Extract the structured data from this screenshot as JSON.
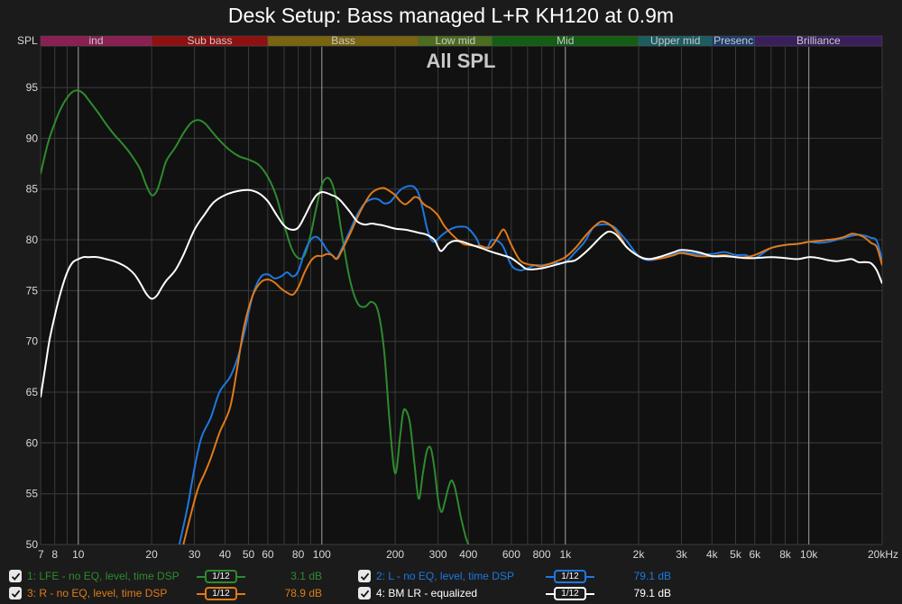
{
  "title": "Desk Setup: Bass managed L+R KH120 at 0.9m",
  "chart_data": {
    "type": "line",
    "subtitle": "All SPL",
    "ylabel": "SPL",
    "xscale": "log",
    "xlim": [
      7,
      20000
    ],
    "ylim": [
      50,
      99
    ],
    "grid": true,
    "x_ticks": [
      {
        "v": 7,
        "label": "7"
      },
      {
        "v": 8,
        "label": "8"
      },
      {
        "v": 10,
        "label": "10"
      },
      {
        "v": 20,
        "label": "20"
      },
      {
        "v": 30,
        "label": "30"
      },
      {
        "v": 40,
        "label": "40"
      },
      {
        "v": 50,
        "label": "50"
      },
      {
        "v": 60,
        "label": "60"
      },
      {
        "v": 80,
        "label": "80"
      },
      {
        "v": 100,
        "label": "100"
      },
      {
        "v": 200,
        "label": "200"
      },
      {
        "v": 300,
        "label": "300"
      },
      {
        "v": 400,
        "label": "400"
      },
      {
        "v": 600,
        "label": "600"
      },
      {
        "v": 800,
        "label": "800"
      },
      {
        "v": 1000,
        "label": "1k"
      },
      {
        "v": 2000,
        "label": "2k"
      },
      {
        "v": 3000,
        "label": "3k"
      },
      {
        "v": 4000,
        "label": "4k"
      },
      {
        "v": 5000,
        "label": "5k"
      },
      {
        "v": 6000,
        "label": "6k"
      },
      {
        "v": 8000,
        "label": "8k"
      },
      {
        "v": 10000,
        "label": "10k"
      },
      {
        "v": 20000,
        "label": "20kHz"
      }
    ],
    "y_ticks": [
      50,
      55,
      60,
      65,
      70,
      75,
      80,
      85,
      90,
      95
    ],
    "bands": [
      {
        "label": "ind",
        "from": 7,
        "to": 20,
        "color": "#8a1f52"
      },
      {
        "label": "Sub bass",
        "from": 20,
        "to": 60,
        "color": "#8e1010"
      },
      {
        "label": "Bass",
        "from": 60,
        "to": 250,
        "color": "#7a6410"
      },
      {
        "label": "Low mid",
        "from": 250,
        "to": 500,
        "color": "#4c6d1e"
      },
      {
        "label": "Mid",
        "from": 500,
        "to": 2000,
        "color": "#155d15"
      },
      {
        "label": "Upper mid",
        "from": 2000,
        "to": 4000,
        "color": "#1c5d62"
      },
      {
        "label": "Presenc",
        "from": 4000,
        "to": 6000,
        "color": "#1d3c6a"
      },
      {
        "label": "Brilliance",
        "from": 6000,
        "to": 20000,
        "color": "#3a1f5c"
      }
    ],
    "series": [
      {
        "name": "1: LFE - no EQ, level, time DSP",
        "color": "#2e8b2e",
        "x": [
          7,
          7.5,
          8,
          8.5,
          9,
          9.5,
          10,
          10.5,
          11,
          12,
          13,
          14,
          15,
          16,
          17,
          18,
          19,
          20,
          21,
          22,
          23,
          25,
          27,
          29,
          31,
          33,
          35,
          38,
          42,
          46,
          50,
          55,
          60,
          65,
          70,
          75,
          80,
          85,
          90,
          95,
          100,
          105,
          110,
          115,
          120,
          130,
          140,
          150,
          160,
          170,
          180,
          190,
          200,
          210,
          215,
          220,
          230,
          240,
          250,
          260,
          270,
          280,
          290,
          300,
          310,
          320,
          330,
          340,
          350,
          360,
          370,
          380,
          390,
          400
        ],
        "y": [
          86.5,
          89.5,
          91.5,
          93,
          94,
          94.6,
          94.7,
          94.4,
          93.8,
          92.6,
          91.4,
          90.4,
          89.6,
          88.8,
          87.9,
          86.9,
          85.4,
          84.4,
          84.8,
          86.3,
          87.8,
          89.1,
          90.5,
          91.5,
          91.8,
          91.5,
          90.8,
          89.8,
          88.8,
          88.2,
          87.9,
          87.4,
          86.2,
          84.3,
          81.5,
          79.2,
          78.2,
          78.5,
          80.5,
          83.2,
          85.4,
          86.1,
          85.6,
          83.8,
          81,
          76.2,
          73.8,
          73.4,
          73.9,
          73,
          69.2,
          62,
          57,
          60.8,
          62.8,
          63.3,
          62,
          58,
          54.5,
          57,
          59.2,
          59.5,
          57.5,
          54.5,
          53.2,
          54.2,
          55.5,
          56.3,
          55.8,
          54.5,
          53,
          51.8,
          50.7,
          50
        ]
      },
      {
        "name": "2: L - no EQ, level, time DSP",
        "color": "#1e78e0",
        "x": [
          26,
          28,
          30,
          32,
          35,
          38,
          42,
          45,
          48,
          52,
          56,
          60,
          64,
          68,
          72,
          76,
          80,
          85,
          90,
          95,
          100,
          105,
          110,
          115,
          120,
          130,
          140,
          150,
          160,
          170,
          180,
          190,
          200,
          210,
          220,
          230,
          240,
          250,
          260,
          270,
          280,
          290,
          300,
          320,
          350,
          380,
          400,
          430,
          450,
          480,
          500,
          550,
          600,
          650,
          700,
          750,
          800,
          900,
          1000,
          1100,
          1200,
          1300,
          1400,
          1500,
          1600,
          1700,
          1800,
          2000,
          2200,
          2500,
          2800,
          3000,
          3500,
          4000,
          4500,
          5000,
          5500,
          6000,
          7000,
          8000,
          9000,
          10000,
          11000,
          12000,
          13000,
          14000,
          15000,
          16000,
          17000,
          18000,
          19000,
          20000
        ],
        "y": [
          50,
          53.5,
          57.5,
          60.5,
          62.5,
          65,
          66.5,
          68.3,
          70.8,
          74.5,
          76.3,
          76.6,
          76.2,
          76.4,
          76.8,
          76.4,
          76.9,
          78.8,
          80,
          80.3,
          79.8,
          79,
          78.5,
          78.2,
          79,
          80.8,
          82.5,
          83.6,
          84,
          84,
          83.6,
          83.7,
          84.3,
          84.9,
          85.2,
          85.3,
          85.2,
          84.5,
          83,
          81.2,
          80.1,
          79.8,
          80.1,
          80.7,
          81.2,
          81.3,
          81.1,
          80.2,
          79.3,
          79.3,
          80,
          79.5,
          77.5,
          77,
          77.2,
          77.5,
          77.5,
          77.7,
          77.8,
          78.8,
          79.8,
          81.2,
          81.5,
          81.5,
          81.2,
          80.5,
          79.8,
          78.4,
          78,
          78.2,
          78.6,
          78.8,
          78.6,
          78.6,
          78.8,
          78.5,
          78.5,
          78.2,
          79.2,
          79.5,
          79.6,
          79.8,
          79.7,
          79.8,
          80,
          80.2,
          80.4,
          80.5,
          80.4,
          80.2,
          79.9,
          78
        ]
      },
      {
        "name": "3: R - no EQ, level, time DSP",
        "color": "#e07a18",
        "x": [
          27,
          29,
          31,
          33,
          35,
          38,
          42,
          45,
          48,
          52,
          56,
          60,
          64,
          68,
          72,
          76,
          80,
          85,
          90,
          95,
          100,
          105,
          110,
          115,
          120,
          130,
          140,
          150,
          160,
          170,
          180,
          190,
          200,
          210,
          220,
          230,
          240,
          250,
          260,
          270,
          280,
          300,
          320,
          350,
          380,
          400,
          430,
          450,
          480,
          500,
          530,
          560,
          600,
          650,
          700,
          750,
          800,
          900,
          1000,
          1100,
          1200,
          1300,
          1400,
          1500,
          1600,
          1700,
          1800,
          2000,
          2200,
          2500,
          2800,
          3000,
          3500,
          4000,
          4500,
          5000,
          5500,
          6000,
          7000,
          8000,
          9000,
          10000,
          11000,
          12000,
          13000,
          14000,
          15000,
          16000,
          17000,
          18000,
          19000,
          20000
        ],
        "y": [
          50,
          53,
          55.5,
          57,
          58.5,
          61,
          63.5,
          67.5,
          71.5,
          74.5,
          75.8,
          76.1,
          75.8,
          75.2,
          74.8,
          74.6,
          75.3,
          76.8,
          77.9,
          78.4,
          78.4,
          78.6,
          78.5,
          78.1,
          78.8,
          80.5,
          82.2,
          83.6,
          84.6,
          85,
          85.1,
          84.8,
          84.4,
          83.8,
          83.5,
          83.8,
          84.2,
          84.1,
          83.6,
          83.3,
          83.1,
          82.4,
          81.3,
          80.3,
          79.6,
          79.5,
          79.4,
          79.4,
          79.2,
          79.4,
          80.3,
          81,
          79.5,
          78,
          77.6,
          77.5,
          77.4,
          77.8,
          78.3,
          79.2,
          80.3,
          81.2,
          81.8,
          81.6,
          81,
          80.1,
          79.2,
          78.4,
          78.1,
          78.2,
          78.5,
          78.7,
          78.4,
          78.4,
          78.5,
          78.3,
          78.3,
          78.5,
          79.2,
          79.5,
          79.6,
          79.8,
          79.9,
          80,
          80.1,
          80.3,
          80.6,
          80.5,
          80.2,
          79.7,
          79.3,
          77.5
        ]
      },
      {
        "name": "4: BM LR - equalized",
        "color": "#ffffff",
        "x": [
          7,
          7.3,
          7.6,
          8,
          8.5,
          9,
          9.5,
          10,
          10.5,
          11,
          12,
          13,
          14,
          15,
          16,
          17,
          18,
          19,
          20,
          21,
          22,
          23,
          25,
          27,
          30,
          33,
          36,
          40,
          45,
          50,
          55,
          60,
          65,
          70,
          75,
          80,
          85,
          90,
          95,
          100,
          105,
          110,
          115,
          120,
          130,
          140,
          150,
          160,
          170,
          180,
          200,
          220,
          250,
          270,
          290,
          300,
          310,
          330,
          350,
          380,
          400,
          450,
          500,
          550,
          600,
          650,
          700,
          800,
          900,
          1000,
          1100,
          1200,
          1300,
          1400,
          1500,
          1600,
          1700,
          1800,
          2000,
          2200,
          2500,
          2800,
          3000,
          3500,
          4000,
          4500,
          5000,
          5500,
          6000,
          7000,
          8000,
          9000,
          10000,
          11000,
          12000,
          13000,
          14000,
          15000,
          16000,
          17000,
          18000,
          19000,
          20000
        ],
        "y": [
          64.5,
          67.3,
          70,
          72.5,
          75,
          76.8,
          77.8,
          78.1,
          78.3,
          78.3,
          78.3,
          78.1,
          77.9,
          77.6,
          77.2,
          76.6,
          75.7,
          74.7,
          74.2,
          74.5,
          75.3,
          76,
          77,
          78.5,
          81,
          82.5,
          83.7,
          84.4,
          84.8,
          84.9,
          84.6,
          83.8,
          82.5,
          81.4,
          81,
          81.2,
          82.3,
          83.5,
          84.4,
          84.7,
          84.6,
          84.4,
          84.2,
          83.8,
          82.8,
          81.8,
          81.5,
          81.6,
          81.5,
          81.4,
          81.1,
          81,
          80.7,
          80.5,
          80,
          79.3,
          78.9,
          79.6,
          79.9,
          79.8,
          79.6,
          79.2,
          78.8,
          78.5,
          78.2,
          77.6,
          77.1,
          77.2,
          77.5,
          77.8,
          78,
          78.7,
          79.5,
          80.3,
          80.8,
          80.6,
          79.9,
          79.2,
          78.4,
          78.1,
          78.4,
          78.8,
          79,
          78.8,
          78.4,
          78.4,
          78.3,
          78.2,
          78.2,
          78.3,
          78.2,
          78.1,
          78.3,
          78.2,
          78,
          77.9,
          78,
          78.1,
          77.8,
          77.8,
          77.7,
          77,
          75.7
        ]
      }
    ]
  },
  "legend": [
    {
      "name": "1: LFE - no EQ, level, time DSP",
      "smoothing": "1/12",
      "value": "3.1 dB",
      "color": "#2e8b2e",
      "checked": true
    },
    {
      "name": "2: L - no EQ, level, time DSP",
      "smoothing": "1/12",
      "value": "79.1 dB",
      "color": "#1e78e0",
      "checked": true
    },
    {
      "name": "3: R - no EQ, level, time DSP",
      "smoothing": "1/12",
      "value": "78.9 dB",
      "color": "#e07a18",
      "checked": true
    },
    {
      "name": "4: BM LR - equalized",
      "smoothing": "1/12",
      "value": "79.1 dB",
      "color": "#ffffff",
      "checked": true
    }
  ]
}
